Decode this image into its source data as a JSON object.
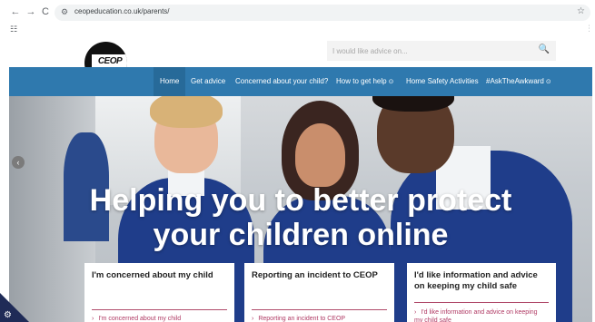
{
  "browser": {
    "back": "←",
    "forward": "→",
    "reload": "C",
    "url": "ceopeducation.co.uk/parents/",
    "star": "☆",
    "apps_glyph": "☷",
    "menu_glyph": "⋮"
  },
  "header": {
    "logo_text": "CEOP",
    "search_placeholder": "I would like advice on...",
    "search_glyph": "🔍"
  },
  "nav": {
    "items": [
      {
        "label": "Home",
        "active": true
      },
      {
        "label": "Get advice"
      },
      {
        "label": "Concerned about your child?"
      },
      {
        "label": "How to get help",
        "chevron": "⊙"
      },
      {
        "label": "Home Safety Activities"
      },
      {
        "label": "#AskTheAwkward",
        "chevron": "⊙"
      }
    ]
  },
  "hero": {
    "title_line1": "Helping you to better protect",
    "title_line2": "your children online",
    "prev_glyph": "‹"
  },
  "cards": [
    {
      "title": "I'm concerned about my child",
      "link": "I'm concerned about my child"
    },
    {
      "title": "Reporting an incident to CEOP",
      "link": "Reporting an incident to CEOP"
    },
    {
      "title": "I'd like information and advice on keeping my child safe",
      "link": "I'd like information and advice on keeping my child safe"
    }
  ],
  "colors": {
    "nav_bg": "#2f79ae",
    "nav_active": "#276a99",
    "link_accent": "#b03a64",
    "blazer": "#1f3d8a"
  }
}
